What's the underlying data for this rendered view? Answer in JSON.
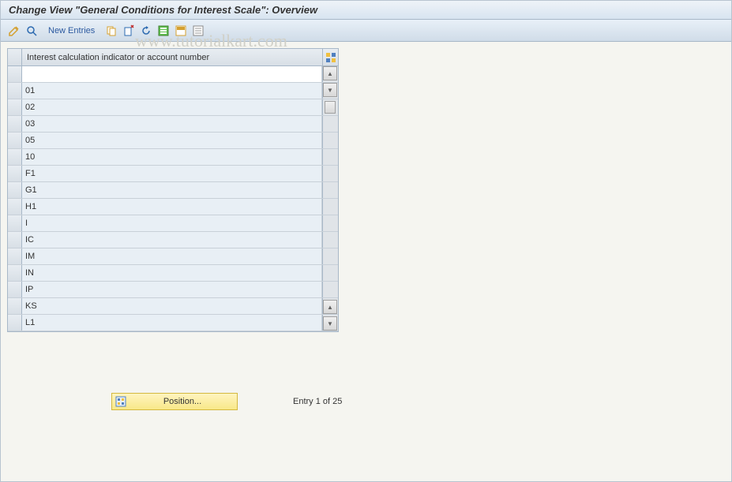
{
  "header": {
    "title": "Change View \"General Conditions for Interest Scale\": Overview"
  },
  "toolbar": {
    "new_entries_label": "New Entries"
  },
  "watermark": "www.tutorialkart.com",
  "table": {
    "column_header": "Interest calculation indicator or account number",
    "rows": [
      "",
      "01",
      "02",
      "03",
      "05",
      "10",
      "F1",
      "G1",
      "H1",
      "I",
      "IC",
      "IM",
      "IN",
      "IP",
      "KS",
      "L1"
    ]
  },
  "footer": {
    "position_label": "Position...",
    "entry_status": "Entry 1 of 25"
  }
}
